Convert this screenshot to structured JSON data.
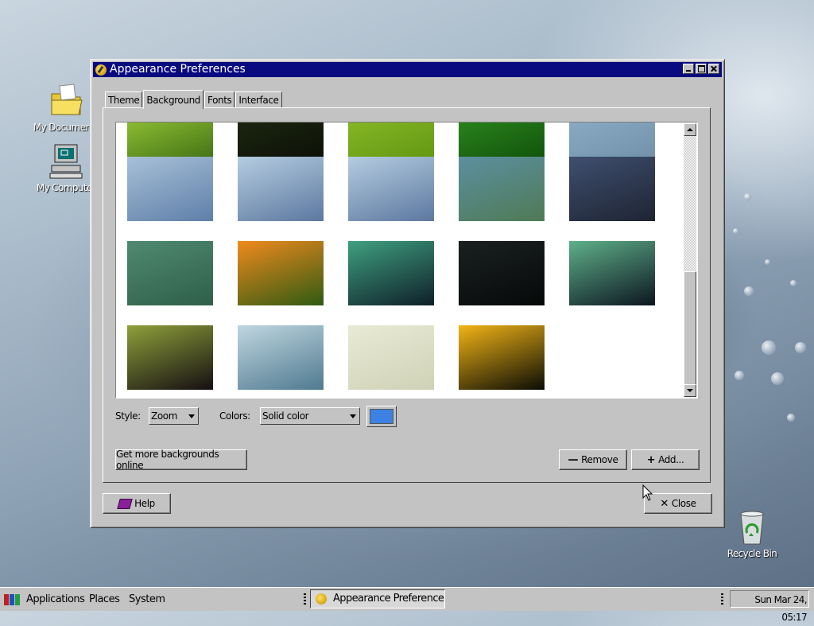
{
  "desktop": {
    "icons": [
      {
        "label": "My Documents",
        "icon": "folder-icon"
      },
      {
        "label": "My Computer",
        "icon": "computer-icon"
      },
      {
        "label": "Recycle Bin",
        "icon": "recycle-bin-icon"
      }
    ]
  },
  "window": {
    "title": "Appearance Preferences",
    "tabs": [
      {
        "label": "Theme"
      },
      {
        "label": "Background",
        "active": true
      },
      {
        "label": "Fonts"
      },
      {
        "label": "Interface"
      }
    ]
  },
  "background": {
    "style_label": "Style:",
    "style_value": "Zoom",
    "colors_label": "Colors:",
    "colors_value": "Solid color",
    "color_swatch": "#3c82e2",
    "get_more_label": "Get more backgrounds online",
    "remove_label": "Remove",
    "add_label": "Add...",
    "help_label": "Help",
    "close_label": "Close",
    "wallpapers": [
      {
        "name": "wallpaper-green-leaf",
        "colors": [
          "#9fcf3a",
          "#3b6a12"
        ]
      },
      {
        "name": "wallpaper-dark-grass",
        "colors": [
          "#1f2a12",
          "#0b0f06"
        ]
      },
      {
        "name": "wallpaper-lime",
        "colors": [
          "#8ebe2a",
          "#5f9410"
        ]
      },
      {
        "name": "wallpaper-green-drops",
        "colors": [
          "#2f8f20",
          "#0f4d0a"
        ]
      },
      {
        "name": "wallpaper-blue-sky",
        "colors": [
          "#8fb0c8",
          "#6f8fa8"
        ]
      },
      {
        "name": "wallpaper-blue-flowers-1",
        "colors": [
          "#a8c0d8",
          "#5e7fa8"
        ]
      },
      {
        "name": "wallpaper-blue-flowers-2",
        "colors": [
          "#b5cce0",
          "#5c78a0"
        ]
      },
      {
        "name": "wallpaper-blue-flowers-3",
        "colors": [
          "#b5cce0",
          "#5c78a0"
        ]
      },
      {
        "name": "wallpaper-green-wave",
        "colors": [
          "#5c8fa0",
          "#4f7a55"
        ]
      },
      {
        "name": "wallpaper-storm-road",
        "colors": [
          "#3f4f6f",
          "#1e2433"
        ]
      },
      {
        "name": "wallpaper-green-stripes",
        "colors": [
          "#4f8a70",
          "#2f5f48"
        ]
      },
      {
        "name": "wallpaper-orange-flower",
        "colors": [
          "#f08a1e",
          "#2f5a12"
        ]
      },
      {
        "name": "wallpaper-aurora-1",
        "colors": [
          "#3fa07f",
          "#0f1f2a"
        ]
      },
      {
        "name": "wallpaper-dark",
        "colors": [
          "#1a2020",
          "#070909"
        ]
      },
      {
        "name": "wallpaper-aurora-2",
        "colors": [
          "#5fb08a",
          "#0c1620"
        ]
      },
      {
        "name": "wallpaper-aurora-3",
        "colors": [
          "#8fa03a",
          "#140f12"
        ]
      },
      {
        "name": "wallpaper-blue-curve",
        "colors": [
          "#c0d6e0",
          "#4f7a90"
        ]
      },
      {
        "name": "wallpaper-sand",
        "colors": [
          "#e8ead5",
          "#cfd2b6"
        ]
      },
      {
        "name": "wallpaper-yellow-flower",
        "colors": [
          "#f2b416",
          "#0a0c05"
        ]
      }
    ]
  },
  "taskbar": {
    "applications": "Applications",
    "places": "Places",
    "system": "System",
    "task_label": "Appearance Preferences",
    "clock": "Sun Mar 24, 05:17"
  }
}
